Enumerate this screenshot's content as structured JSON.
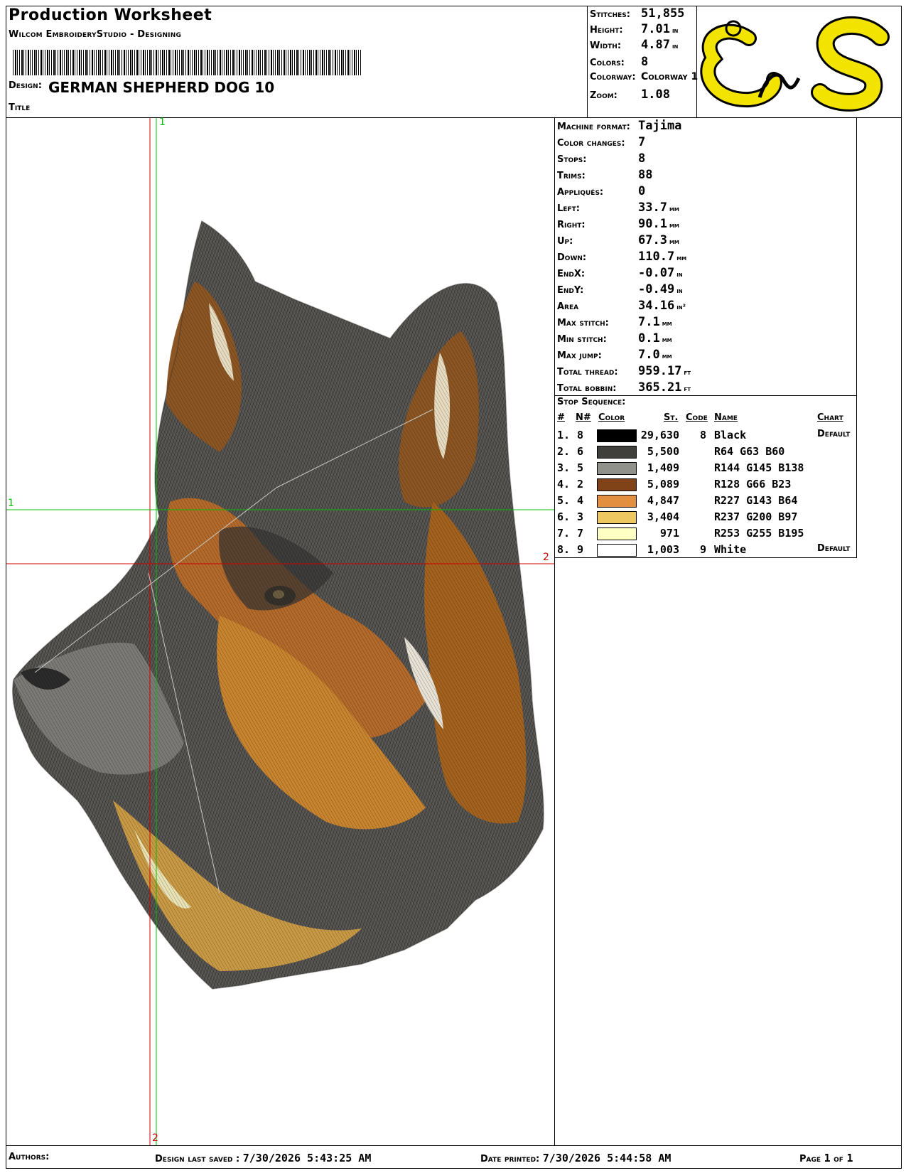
{
  "header": {
    "title": "Production Worksheet",
    "software": "Wilcom EmbroideryStudio - Designing",
    "design_label": "Design:",
    "design_value": "GERMAN SHEPHERD DOG  10",
    "title_label": "Title"
  },
  "summary": {
    "stitches": {
      "label": "Stitches:",
      "value": "51,855",
      "unit": ""
    },
    "height": {
      "label": "Height:",
      "value": "7.01",
      "unit": "in"
    },
    "width": {
      "label": "Width:",
      "value": "4.87",
      "unit": "in"
    },
    "colors": {
      "label": "Colors:",
      "value": "8",
      "unit": ""
    },
    "colorway": {
      "label": "Colorway:",
      "value": "Colorway 1",
      "unit": ""
    },
    "zoom": {
      "label": "Zoom:",
      "value": "1.08",
      "unit": ""
    }
  },
  "logo": {
    "text": "EnS",
    "color": "#f2e300"
  },
  "details": [
    {
      "label": "Machine format:",
      "value": "Tajima",
      "unit": ""
    },
    {
      "label": "Color changes:",
      "value": "7",
      "unit": ""
    },
    {
      "label": "Stops:",
      "value": "8",
      "unit": ""
    },
    {
      "label": "Trims:",
      "value": "88",
      "unit": ""
    },
    {
      "label": "Appliqués:",
      "value": "0",
      "unit": ""
    },
    {
      "label": "Left:",
      "value": "33.7",
      "unit": "mm"
    },
    {
      "label": "Right:",
      "value": "90.1",
      "unit": "mm"
    },
    {
      "label": "Up:",
      "value": "67.3",
      "unit": "mm"
    },
    {
      "label": "Down:",
      "value": "110.7",
      "unit": "mm"
    },
    {
      "label": "EndX:",
      "value": "-0.07",
      "unit": "in"
    },
    {
      "label": "EndY:",
      "value": "-0.49",
      "unit": "in"
    },
    {
      "label": "Area",
      "value": "34.16",
      "unit": "in²"
    },
    {
      "label": "Max stitch:",
      "value": "7.1",
      "unit": "mm"
    },
    {
      "label": "Min stitch:",
      "value": "0.1",
      "unit": "mm"
    },
    {
      "label": "Max jump:",
      "value": "7.0",
      "unit": "mm"
    },
    {
      "label": "Total thread:",
      "value": "959.17",
      "unit": "ft"
    },
    {
      "label": "Total bobbin:",
      "value": "365.21",
      "unit": "ft"
    }
  ],
  "stop_sequence": {
    "title": "Stop Sequence:",
    "headers": {
      "num": "#",
      "n": "N#",
      "color": "Color",
      "st": "St.",
      "code": "Code",
      "name": "Name",
      "chart": "Chart"
    },
    "rows": [
      {
        "num": "1.",
        "n": "8",
        "swatch": "#000000",
        "st": "29,630",
        "code": "8",
        "name": "Black",
        "chart": "Default"
      },
      {
        "num": "2.",
        "n": "6",
        "swatch": "#403f3c",
        "st": "5,500",
        "code": "",
        "name": "R64 G63 B60",
        "chart": ""
      },
      {
        "num": "3.",
        "n": "5",
        "swatch": "#90918a",
        "st": "1,409",
        "code": "",
        "name": "R144 G145 B138",
        "chart": ""
      },
      {
        "num": "4.",
        "n": "2",
        "swatch": "#804217",
        "st": "5,089",
        "code": "",
        "name": "R128 G66 B23",
        "chart": ""
      },
      {
        "num": "5.",
        "n": "4",
        "swatch": "#e38f40",
        "st": "4,847",
        "code": "",
        "name": "R227 G143 B64",
        "chart": ""
      },
      {
        "num": "6.",
        "n": "3",
        "swatch": "#edc861",
        "st": "3,404",
        "code": "",
        "name": "R237 G200 B97",
        "chart": ""
      },
      {
        "num": "7.",
        "n": "7",
        "swatch": "#fdffc3",
        "st": "971",
        "code": "",
        "name": "R253 G255 B195",
        "chart": ""
      },
      {
        "num": "8.",
        "n": "9",
        "swatch": "#ffffff",
        "st": "1,003",
        "code": "9",
        "name": "White",
        "chart": "Default"
      }
    ]
  },
  "canvas": {
    "guide_labels": {
      "top": "1",
      "left": "1",
      "right": "2",
      "bottom": "2"
    },
    "guide_colors": {
      "green": "#00c000",
      "red": "#d00000"
    }
  },
  "footer": {
    "authors_label": "Authors:",
    "saved_label": "Design last saved :",
    "saved_value": "7/30/2026 5:43:25 AM",
    "printed_label": "Date printed:",
    "printed_value": "7/30/2026 5:44:58 AM",
    "page_label": "Page",
    "page_value": "1",
    "of_label": "of",
    "page_total": "1"
  }
}
